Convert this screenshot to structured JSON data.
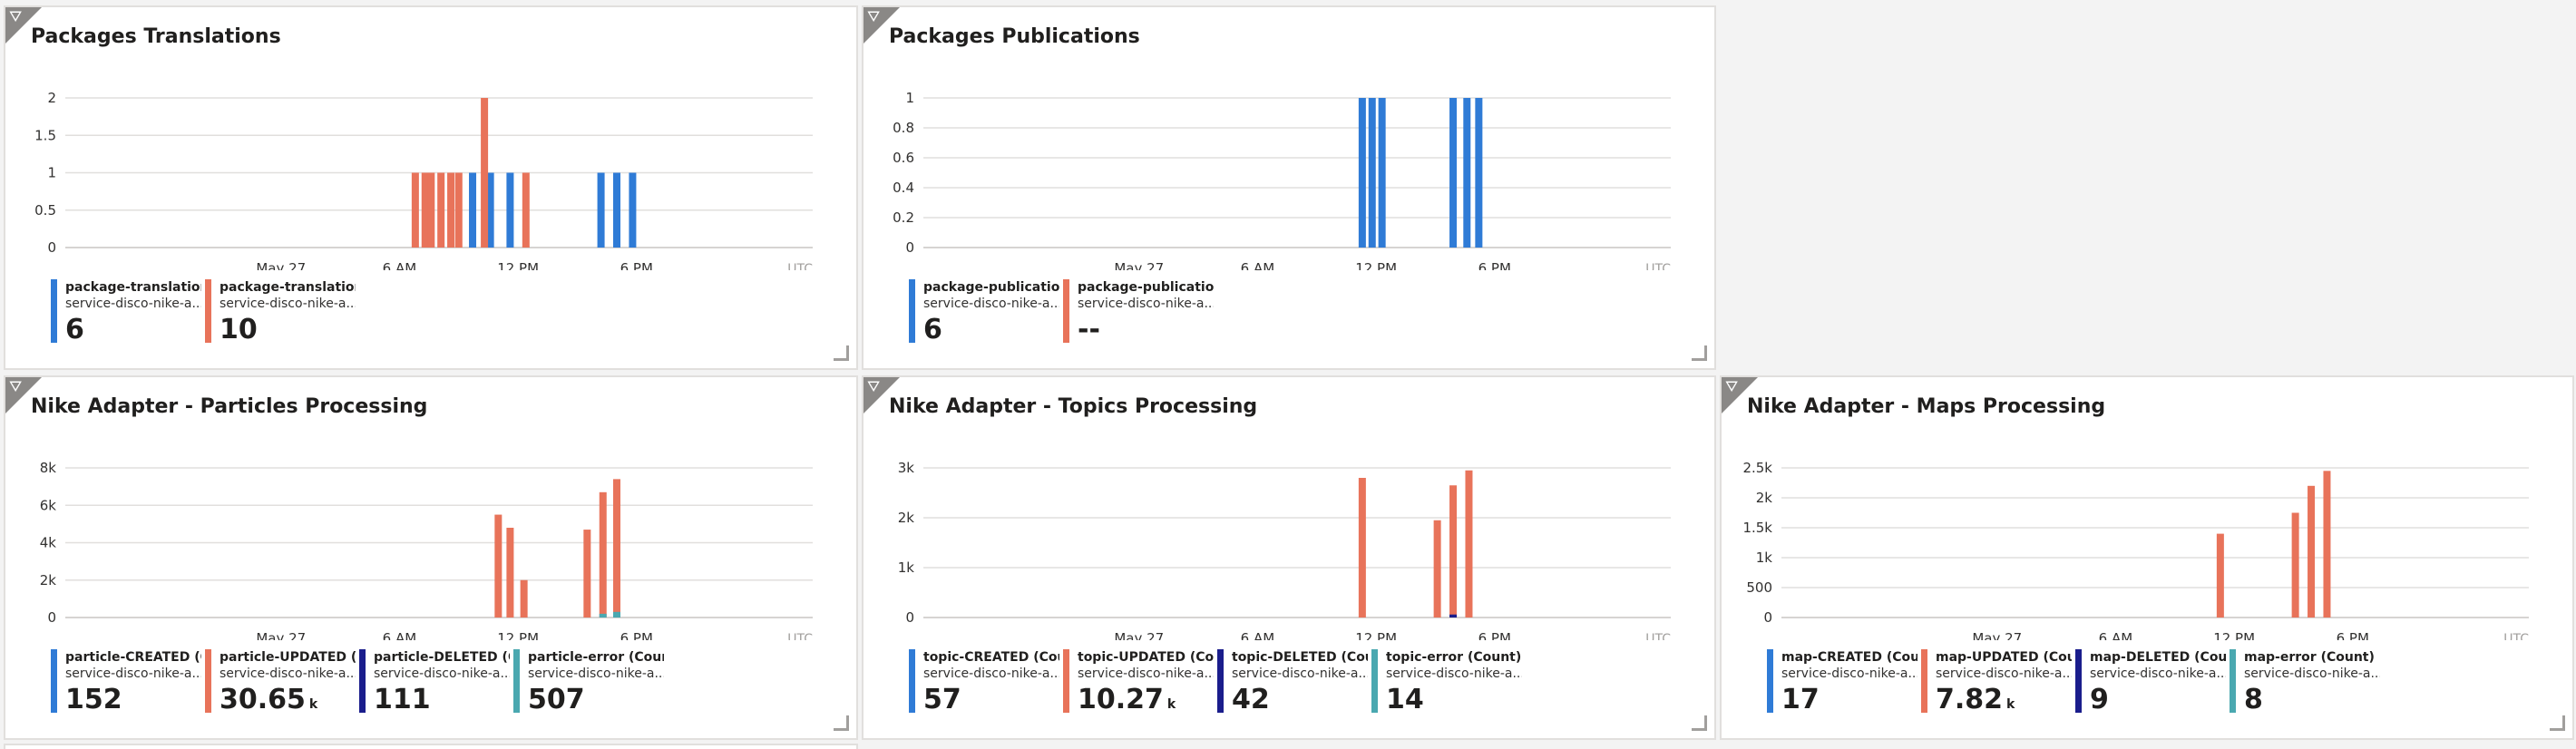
{
  "colors": {
    "blue": "#2f7bd6",
    "orange": "#e8735a",
    "navy": "#1a1d8c",
    "teal": "#4aa8b0"
  },
  "x_ticks": [
    "May 27",
    "6 AM",
    "12 PM",
    "6 PM"
  ],
  "utc_label": "UTC",
  "filter_icon": "filter-icon",
  "tiles": [
    {
      "id": "packages-translations",
      "title": "Packages Translations",
      "legend": [
        {
          "name": "package-translation-...",
          "sub": "service-disco-nike-a...",
          "value": "6",
          "suffix": "",
          "color": "blue"
        },
        {
          "name": "package-translation-...",
          "sub": "service-disco-nike-a...",
          "value": "10",
          "suffix": "",
          "color": "orange"
        }
      ]
    },
    {
      "id": "packages-publications",
      "title": "Packages Publications",
      "legend": [
        {
          "name": "package-publication-...",
          "sub": "service-disco-nike-a...",
          "value": "6",
          "suffix": "",
          "color": "blue"
        },
        {
          "name": "package-publication-...",
          "sub": "service-disco-nike-a...",
          "value": "--",
          "suffix": "",
          "color": "orange"
        }
      ]
    },
    {
      "id": "particles-processing",
      "title": "Nike Adapter - Particles Processing",
      "legend": [
        {
          "name": "particle-CREATED (Co...",
          "sub": "service-disco-nike-a...",
          "value": "152",
          "suffix": "",
          "color": "blue"
        },
        {
          "name": "particle-UPDATED (Co...",
          "sub": "service-disco-nike-a...",
          "value": "30.65",
          "suffix": "k",
          "color": "orange"
        },
        {
          "name": "particle-DELETED (Co...",
          "sub": "service-disco-nike-a...",
          "value": "111",
          "suffix": "",
          "color": "navy"
        },
        {
          "name": "particle-error (Count)",
          "sub": "service-disco-nike-a...",
          "value": "507",
          "suffix": "",
          "color": "teal"
        }
      ]
    },
    {
      "id": "topics-processing",
      "title": "Nike Adapter - Topics Processing",
      "legend": [
        {
          "name": "topic-CREATED (Count)",
          "sub": "service-disco-nike-a...",
          "value": "57",
          "suffix": "",
          "color": "blue"
        },
        {
          "name": "topic-UPDATED (Count)",
          "sub": "service-disco-nike-a...",
          "value": "10.27",
          "suffix": "k",
          "color": "orange"
        },
        {
          "name": "topic-DELETED (Count)",
          "sub": "service-disco-nike-a...",
          "value": "42",
          "suffix": "",
          "color": "navy"
        },
        {
          "name": "topic-error (Count)",
          "sub": "service-disco-nike-a...",
          "value": "14",
          "suffix": "",
          "color": "teal"
        }
      ]
    },
    {
      "id": "maps-processing",
      "title": "Nike Adapter - Maps Processing",
      "legend": [
        {
          "name": "map-CREATED (Count)",
          "sub": "service-disco-nike-a...",
          "value": "17",
          "suffix": "",
          "color": "blue"
        },
        {
          "name": "map-UPDATED (Count)",
          "sub": "service-disco-nike-a...",
          "value": "7.82",
          "suffix": "k",
          "color": "orange"
        },
        {
          "name": "map-DELETED (Count)",
          "sub": "service-disco-nike-a...",
          "value": "9",
          "suffix": "",
          "color": "navy"
        },
        {
          "name": "map-error (Count)",
          "sub": "service-disco-nike-a...",
          "value": "8",
          "suffix": "",
          "color": "teal"
        }
      ]
    }
  ],
  "chart_data": [
    {
      "type": "bar",
      "title": "Packages Translations",
      "x_range_hours": [
        -10,
        26
      ],
      "yticks": [
        "0",
        "0.5",
        "1",
        "1.5",
        "2"
      ],
      "ylim": [
        0,
        2
      ],
      "series": [
        {
          "name": "package-translation-...",
          "color": "blue",
          "points": [
            [
              9.7,
              1
            ],
            [
              10.6,
              1
            ],
            [
              11.6,
              1
            ],
            [
              16.2,
              1
            ],
            [
              17.0,
              1
            ],
            [
              17.8,
              1
            ]
          ]
        },
        {
          "name": "package-translation-...",
          "color": "orange",
          "points": [
            [
              6.8,
              1
            ],
            [
              7.3,
              1
            ],
            [
              7.6,
              1
            ],
            [
              8.1,
              1
            ],
            [
              8.6,
              1
            ],
            [
              9.0,
              1
            ],
            [
              10.3,
              2
            ],
            [
              12.4,
              1
            ]
          ]
        }
      ]
    },
    {
      "type": "bar",
      "title": "Packages Publications",
      "x_range_hours": [
        -10,
        26
      ],
      "yticks": [
        "0",
        "0.2",
        "0.4",
        "0.6",
        "0.8",
        "1"
      ],
      "ylim": [
        0,
        1
      ],
      "series": [
        {
          "name": "package-publication-...",
          "color": "blue",
          "points": [
            [
              11.3,
              1
            ],
            [
              11.8,
              1
            ],
            [
              12.3,
              1
            ],
            [
              15.9,
              1
            ],
            [
              16.6,
              1
            ],
            [
              17.2,
              1
            ]
          ]
        }
      ]
    },
    {
      "type": "bar",
      "title": "Nike Adapter - Particles Processing",
      "x_range_hours": [
        -10,
        26
      ],
      "yticks": [
        "0",
        "2k",
        "4k",
        "6k",
        "8k"
      ],
      "ylim": [
        0,
        8000
      ],
      "series": [
        {
          "name": "particle-UPDATED (Co...",
          "color": "orange",
          "points": [
            [
              11.0,
              5500
            ],
            [
              11.6,
              4800
            ],
            [
              12.3,
              2000
            ],
            [
              15.5,
              4700
            ],
            [
              16.3,
              6700
            ],
            [
              17.0,
              7400
            ]
          ]
        },
        {
          "name": "particle-error (Count)",
          "color": "teal",
          "points": [
            [
              16.3,
              200
            ],
            [
              17.0,
              300
            ]
          ]
        }
      ]
    },
    {
      "type": "bar",
      "title": "Nike Adapter - Topics Processing",
      "x_range_hours": [
        -10,
        26
      ],
      "yticks": [
        "0",
        "1k",
        "2k",
        "3k"
      ],
      "ylim": [
        0,
        3000
      ],
      "series": [
        {
          "name": "topic-UPDATED (Count)",
          "color": "orange",
          "points": [
            [
              11.3,
              2800
            ],
            [
              15.1,
              1950
            ],
            [
              15.9,
              2650
            ],
            [
              16.7,
              2950
            ]
          ]
        },
        {
          "name": "topic-DELETED (Count)",
          "color": "navy",
          "points": [
            [
              15.9,
              60
            ]
          ]
        }
      ]
    },
    {
      "type": "bar",
      "title": "Nike Adapter - Maps Processing",
      "x_range_hours": [
        -10,
        26
      ],
      "yticks": [
        "0",
        "500",
        "1k",
        "1.5k",
        "2k",
        "2.5k"
      ],
      "ylim": [
        0,
        2500
      ],
      "series": [
        {
          "name": "map-UPDATED (Count)",
          "color": "orange",
          "points": [
            [
              11.3,
              1400
            ],
            [
              15.1,
              1750
            ],
            [
              15.9,
              2200
            ],
            [
              16.7,
              2450
            ]
          ]
        }
      ]
    }
  ]
}
